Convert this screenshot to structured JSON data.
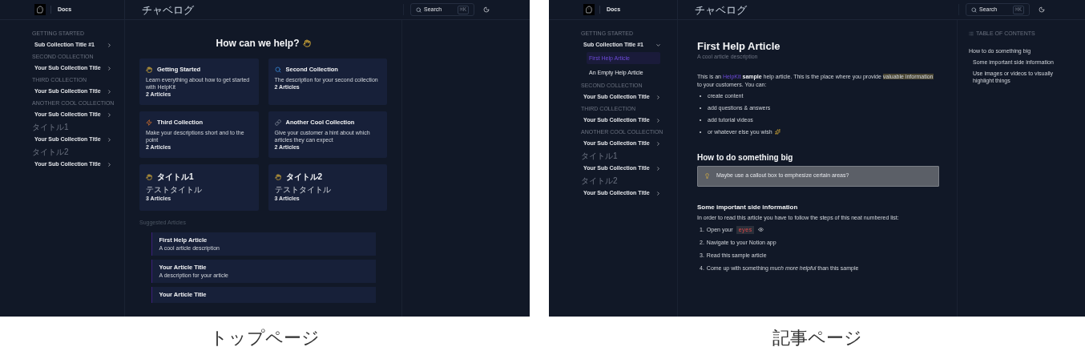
{
  "screens": [
    {
      "caption": "トップページ",
      "header": {
        "brand": "Docs",
        "nav_link": "チャベログ",
        "search": {
          "placeholder": "Search",
          "shortcut": "⌘K"
        }
      },
      "sidebar": [
        {
          "label": "GETTING STARTED",
          "items": [
            {
              "title": "Sub Collection Title #1",
              "expanded": false
            }
          ]
        },
        {
          "label": "SECOND COLLECTION",
          "items": [
            {
              "title": "Your Sub Collection Title",
              "expanded": false
            }
          ]
        },
        {
          "label": "THIRD COLLECTION",
          "items": [
            {
              "title": "Your Sub Collection Title",
              "expanded": false
            }
          ]
        },
        {
          "label": "ANOTHER COOL COLLECTION",
          "items": [
            {
              "title": "Your Sub Collection Title",
              "expanded": false
            }
          ]
        },
        {
          "label": "タイトル1",
          "items": [
            {
              "title": "Your Sub Collection Title",
              "expanded": false
            }
          ]
        },
        {
          "label": "タイトル2",
          "items": [
            {
              "title": "Your Sub Collection Title",
              "expanded": false
            }
          ]
        }
      ],
      "home": {
        "heading": "How can we help?",
        "collections": [
          {
            "title": "Getting Started",
            "description": "Learn everything about how to get started with HelpKit",
            "count": "2 Articles"
          },
          {
            "title": "Second Collection",
            "description": "The description for your second collection",
            "count": "2 Articles"
          },
          {
            "title": "Third Collection",
            "description": "Make your descriptions short and to the point",
            "count": "2 Articles"
          },
          {
            "title": "Another Cool Collection",
            "description": "Give your customer a hint about which articles they can expect",
            "count": "2 Articles"
          },
          {
            "title": "タイトル1",
            "description": "テストタイトル",
            "count": "3 Articles"
          },
          {
            "title": "タイトル2",
            "description": "テストタイトル",
            "count": "3 Articles"
          }
        ],
        "suggested_label": "Suggested Articles",
        "suggested": [
          {
            "title": "First Help Article",
            "description": "A cool article description"
          },
          {
            "title": "Your Article Title",
            "description": "A description for your article"
          },
          {
            "title": "Your Article Title"
          }
        ]
      }
    },
    {
      "caption": "記事ページ",
      "header": {
        "brand": "Docs",
        "nav_link": "チャベログ",
        "search": {
          "placeholder": "Search",
          "shortcut": "⌘K"
        }
      },
      "sidebar": [
        {
          "label": "GETTING STARTED",
          "items": [
            {
              "title": "Sub Collection Title #1",
              "expanded": true,
              "children": [
                {
                  "title": "First Help Article",
                  "selected": true
                },
                {
                  "title": "An Empty Help Article",
                  "selected": false
                }
              ]
            }
          ]
        },
        {
          "label": "SECOND COLLECTION",
          "items": [
            {
              "title": "Your Sub Collection Title",
              "expanded": false
            }
          ]
        },
        {
          "label": "THIRD COLLECTION",
          "items": [
            {
              "title": "Your Sub Collection Title",
              "expanded": false
            }
          ]
        },
        {
          "label": "ANOTHER COOL COLLECTION",
          "items": [
            {
              "title": "Your Sub Collection Title",
              "expanded": false
            }
          ]
        },
        {
          "label": "タイトル1",
          "items": [
            {
              "title": "Your Sub Collection Title",
              "expanded": false
            }
          ]
        },
        {
          "label": "タイトル2",
          "items": [
            {
              "title": "Your Sub Collection Title",
              "expanded": false
            }
          ]
        }
      ],
      "article": {
        "title": "First Help Article",
        "subtitle": "A cool article description",
        "intro": [
          {
            "kind": "text",
            "text": "This is an "
          },
          {
            "kind": "link",
            "text": "HelpKit"
          },
          {
            "kind": "bold",
            "text": "sample"
          },
          {
            "kind": "text",
            "text": " help article. This is the place where you provide "
          },
          {
            "kind": "highlight",
            "text": "valuable information"
          },
          {
            "kind": "text",
            "text": " to your customers. You can:"
          }
        ],
        "bullets": [
          {
            "text": "create content",
            "emoji": false
          },
          {
            "text": "add questions & answers",
            "emoji": false
          },
          {
            "text": "add tutorial videos",
            "emoji": false
          },
          {
            "text": "or whatever else you wish",
            "emoji": true
          }
        ],
        "heading": "How to do something big",
        "callout": "Maybe use a callout box to emphesize certain areas?",
        "subheading": "Some important side information",
        "lead": "In order to read this article you have to follow the steps of this neat numbered list:",
        "steps": [
          {
            "number": "1.",
            "parts": [
              {
                "kind": "text",
                "text": "Open your"
              },
              {
                "kind": "code",
                "text": "eyes"
              }
            ],
            "emoji": true
          },
          {
            "number": "2.",
            "parts": [
              {
                "kind": "text",
                "text": "Navigate to your Notion app"
              }
            ],
            "emoji": false
          },
          {
            "number": "3.",
            "parts": [
              {
                "kind": "text",
                "text": "Read this sample article"
              }
            ],
            "emoji": false
          },
          {
            "number": "4.",
            "parts": [
              {
                "kind": "text",
                "text": "Come up with something *much more helpful* than this sample"
              }
            ],
            "emoji": false
          }
        ]
      },
      "toc": {
        "title": "TABLE OF CONTENTS",
        "items": [
          {
            "title": "How to do something big",
            "children": [
              {
                "title": "Some important side information"
              },
              {
                "title": "Use images or videos to visually highlight things"
              }
            ]
          }
        ]
      }
    }
  ]
}
